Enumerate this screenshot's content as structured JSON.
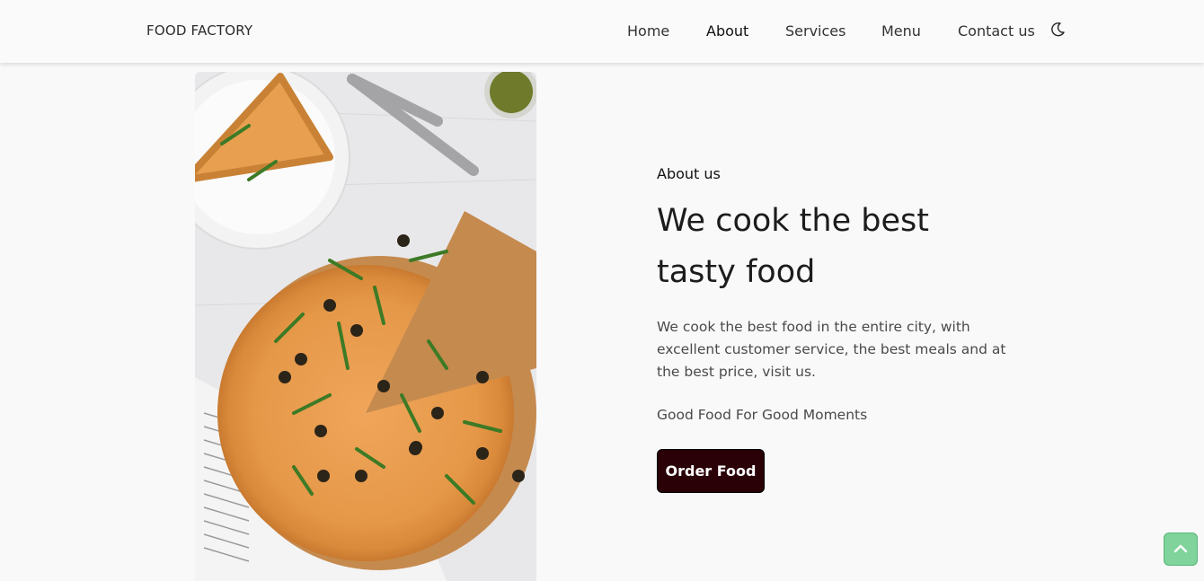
{
  "header": {
    "brand": "FOOD FACTORY",
    "nav": [
      {
        "label": "Home"
      },
      {
        "label": "About"
      },
      {
        "label": "Services"
      },
      {
        "label": "Menu"
      },
      {
        "label": "Contact us"
      }
    ],
    "active_nav": "About",
    "theme_toggle_icon": "moon-icon"
  },
  "about": {
    "eyebrow": "About us",
    "title_line1": "We cook the best",
    "title_line2": "tasty food",
    "description": "We cook the best food in the entire city, with excellent customer service, the best meals and at the best price, visit us.",
    "slogan": "Good Food For Good Moments",
    "order_button": "Order Food"
  },
  "scroll_top_icon": "chevron-up-icon",
  "colors": {
    "background": "#f9f9f9",
    "order_button": "#2a0107",
    "scroll_top": "#7fd39b"
  }
}
